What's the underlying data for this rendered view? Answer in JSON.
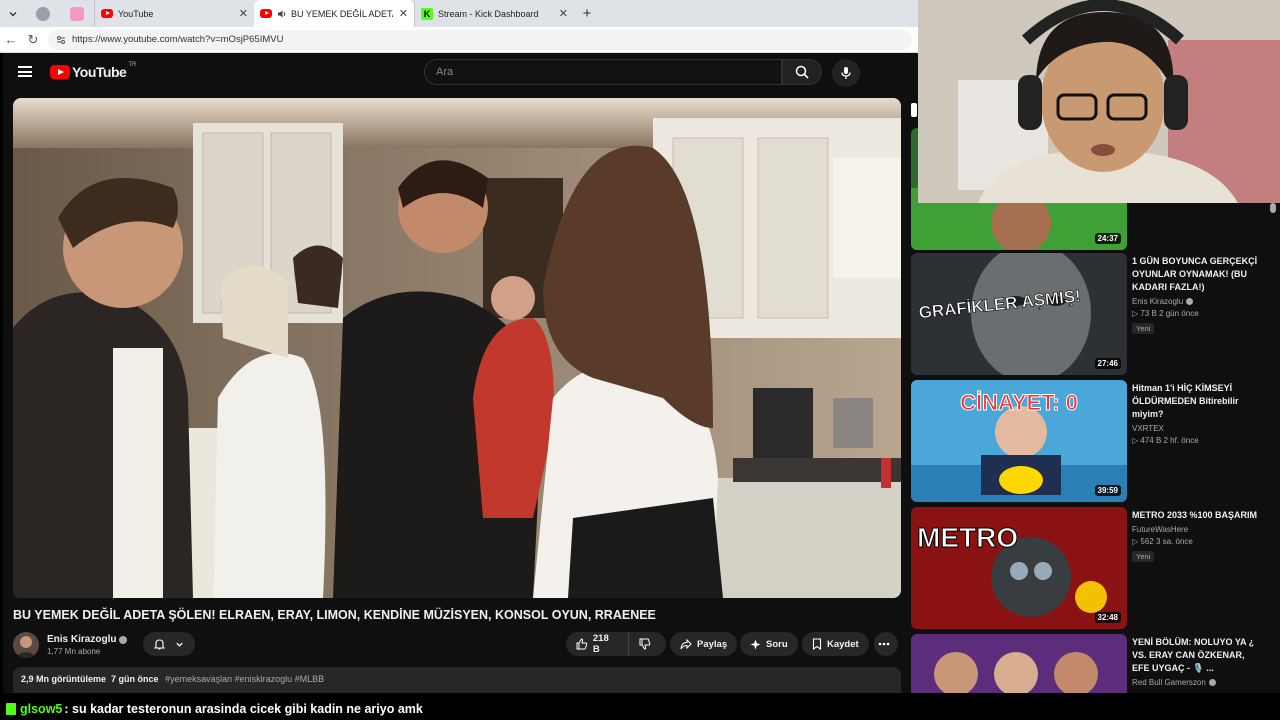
{
  "browser": {
    "tabs": [
      {
        "title": "YouTube",
        "icon": "youtube-icon",
        "active": false
      },
      {
        "title": "BU YEMEK DEĞİL ADETA ŞÖLEN",
        "icon": "youtube-icon",
        "active": true
      },
      {
        "title": "Stream - Kick Dashboard",
        "icon": "kick-icon",
        "active": false
      }
    ],
    "new_tab": "+",
    "url": "https://www.youtube.com/watch?v=mOsjP65IMVU"
  },
  "youtube": {
    "logo_text": "YouTube",
    "country_code": "TR",
    "search_placeholder": "Ara",
    "video": {
      "title": "BU YEMEK DEĞİL ADETA ŞÖLEN! ELRAEN, ERAY, LIMON, KENDİNE MÜZİSYEN, KONSOL OYUN, RRAENEE",
      "channel": "Enis Kirazoglu",
      "subscribers": "1,77 Mn abone",
      "likes": "218 B",
      "share_label": "Paylaş",
      "ask_label": "Soru",
      "save_label": "Kaydet",
      "views": "2,9 Mn görüntüleme",
      "age": "7 gün önce",
      "hashtags": "#yemeksavaşlan #eniskirazoglu #MLBB"
    },
    "recommendations": [
      {
        "title": "",
        "channel": "",
        "stats": "",
        "duration": "24:37",
        "badge": ""
      },
      {
        "title": "1 GÜN BOYUNCA GERÇEKÇİ OYUNLAR OYNAMAK! (BU KADARI FAZLA!)",
        "channel": "Enis Kirazoglu",
        "stats": "▷ 73 B   2 gün önce",
        "duration": "27:46",
        "badge": "Yeni",
        "thumb_text": "GRAFİKLER AŞMIŞ!"
      },
      {
        "title": "Hitman 1'i HİÇ KİMSEYİ ÖLDÜRMEDEN Bitirebilir miyim?",
        "channel": "VXRTEX",
        "stats": "▷ 474 B   2 hf. önce",
        "duration": "39:59",
        "badge": "",
        "thumb_text": "CİNAYET: 0"
      },
      {
        "title": "METRO 2033 %100 BAŞARIM",
        "channel": "FutureWasHere",
        "stats": "▷ 562   3 sa. önce",
        "duration": "32:48",
        "badge": "Yeni",
        "thumb_text": "METRO"
      },
      {
        "title": "YENİ BÖLÜM: NOLUYO YA ¿ VS. ERAY CAN ÖZKENAR, EFE UYGAÇ - 🎙️ ...",
        "channel": "Red Bull Gamerszon",
        "stats": "",
        "duration": "",
        "badge": ""
      }
    ]
  },
  "chat": {
    "user": "glsow5",
    "message": ": su kadar testeronun arasinda cicek gibi kadin ne ariyo amk"
  },
  "colors": {
    "youtube_red": "#ff0000",
    "kick_green": "#53fc18",
    "yt_background": "#0f0f0f"
  }
}
